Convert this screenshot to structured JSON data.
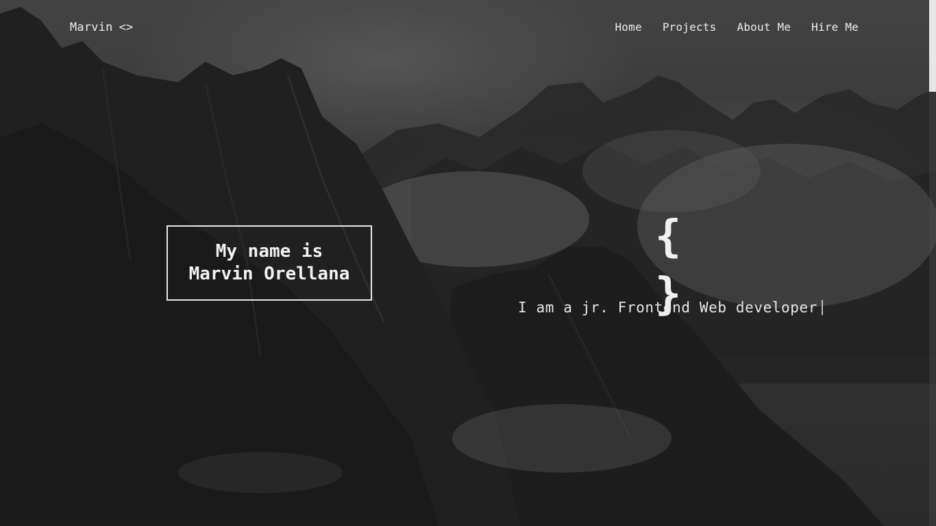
{
  "nav": {
    "brand": "Marvin",
    "brand_icon": "<>",
    "links": [
      {
        "label": "Home"
      },
      {
        "label": "Projects"
      },
      {
        "label": "About Me"
      },
      {
        "label": "Hire Me"
      }
    ]
  },
  "hero": {
    "name_line1": "My name is",
    "name_line2": "Marvin Orellana",
    "icon": "{ }",
    "tagline": "I am a jr. Frontend Web developer"
  }
}
